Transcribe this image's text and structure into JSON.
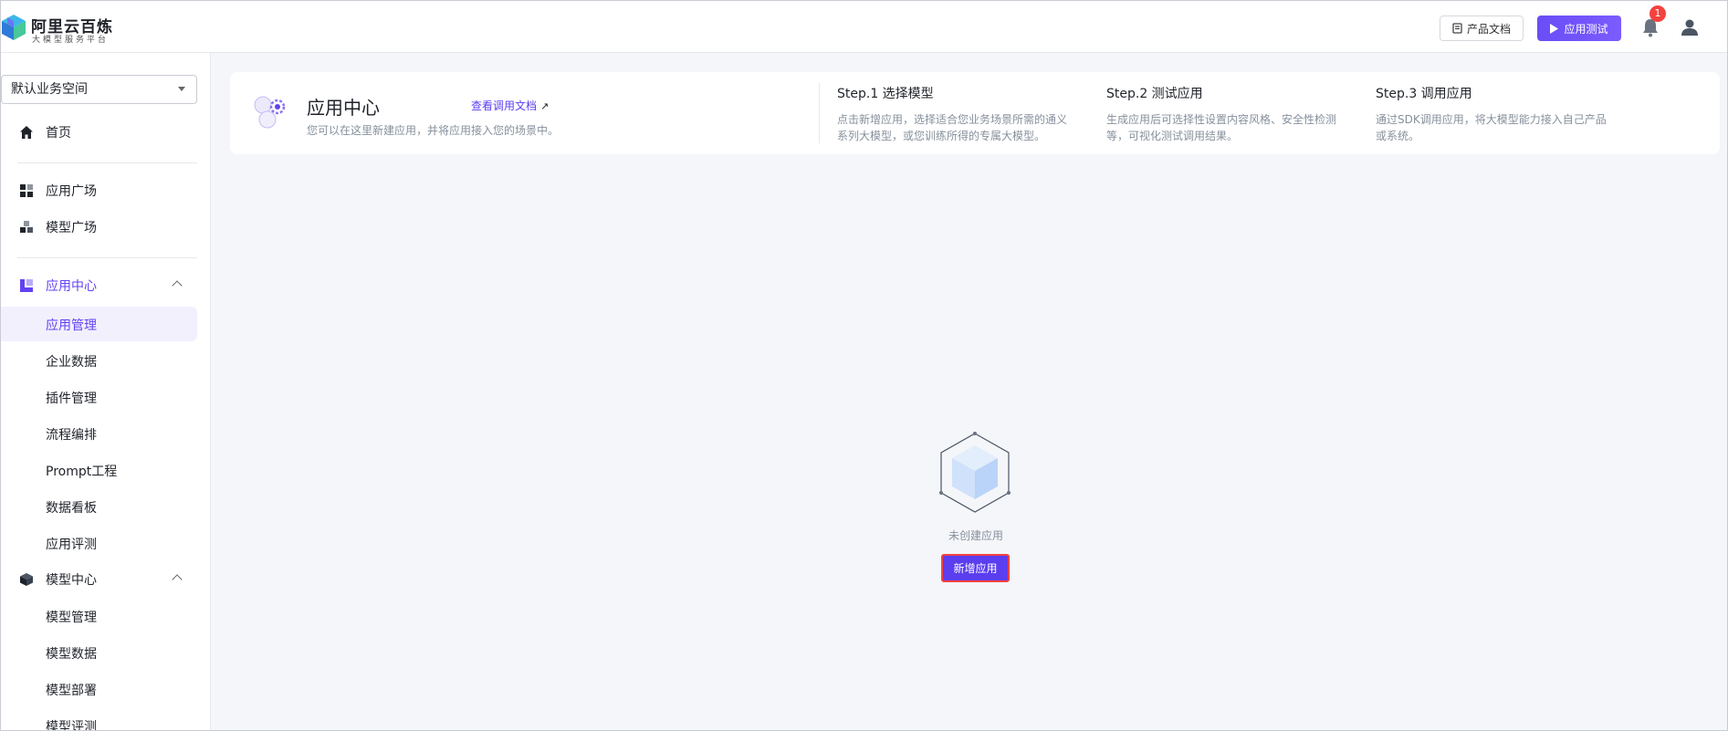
{
  "header": {
    "logo_title": "阿里云百炼",
    "logo_subtitle": "大模型服务平台",
    "docs_button": "产品文档",
    "test_button": "应用测试",
    "notification_count": "1",
    "accent_color": "#6241f2"
  },
  "sidebar": {
    "workspace": "默认业务空间",
    "home": "首页",
    "app_plaza": "应用广场",
    "model_plaza": "模型广场",
    "app_center": "应用中心",
    "app_center_items": [
      "应用管理",
      "企业数据",
      "插件管理",
      "流程编排",
      "Prompt工程",
      "数据看板",
      "应用评测"
    ],
    "model_center": "模型中心",
    "model_center_items": [
      "模型管理",
      "模型数据",
      "模型部署",
      "模型评测"
    ]
  },
  "banner": {
    "title": "应用中心",
    "description": "您可以在这里新建应用，并将应用接入您的场景中。",
    "doc_link": "查看调用文档",
    "steps": [
      {
        "title": "Step.1 选择模型",
        "desc": "点击新增应用，选择适合您业务场景所需的通义系列大模型，或您训练所得的专属大模型。"
      },
      {
        "title": "Step.2 测试应用",
        "desc": "生成应用后可选择性设置内容风格、安全性检测等，可视化测试调用结果。"
      },
      {
        "title": "Step.3 调用应用",
        "desc": "通过SDK调用应用，将大模型能力接入自己产品或系统。"
      }
    ]
  },
  "empty_state": {
    "message": "未创建应用",
    "button": "新增应用"
  }
}
